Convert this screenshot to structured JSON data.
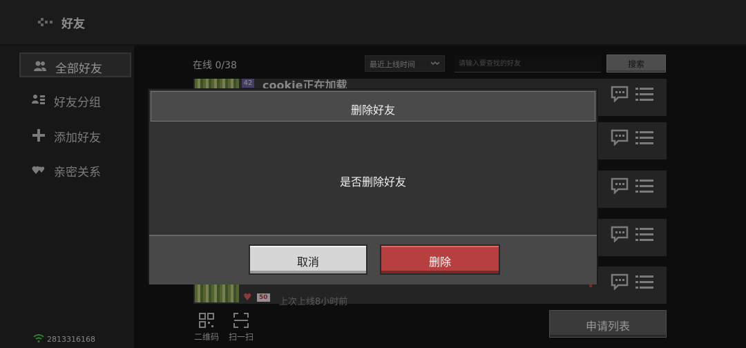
{
  "header": {
    "title": "好友"
  },
  "sidebar": {
    "items": [
      {
        "label": "全部好友",
        "icon": "friends-icon",
        "active": true
      },
      {
        "label": "好友分组",
        "icon": "group-icon",
        "active": false
      },
      {
        "label": "添加好友",
        "icon": "plus-icon",
        "active": false
      },
      {
        "label": "亲密关系",
        "icon": "hearts-icon",
        "active": false
      }
    ],
    "user_id": "2813316168"
  },
  "friends": {
    "online_count": "在线 0/38",
    "sort_select": "最近上线时间",
    "search_placeholder": "请输入要查找的好友",
    "search_button": "搜索",
    "rows": [
      {
        "level": "42",
        "name": "cookie正在加载"
      },
      {
        "heart_level": "50",
        "last_online": "上次上线8小时前"
      }
    ]
  },
  "bottom": {
    "qr_label": "二维码",
    "scan_label": "扫一扫",
    "request_list": "申请列表"
  },
  "dialog": {
    "title": "删除好友",
    "message": "是否删除好友",
    "cancel": "取消",
    "confirm": "删除"
  },
  "colors": {
    "delete_red": "#b83f3f",
    "badge_purple": "#6b5f99",
    "wifi_green": "#3ec93e"
  }
}
